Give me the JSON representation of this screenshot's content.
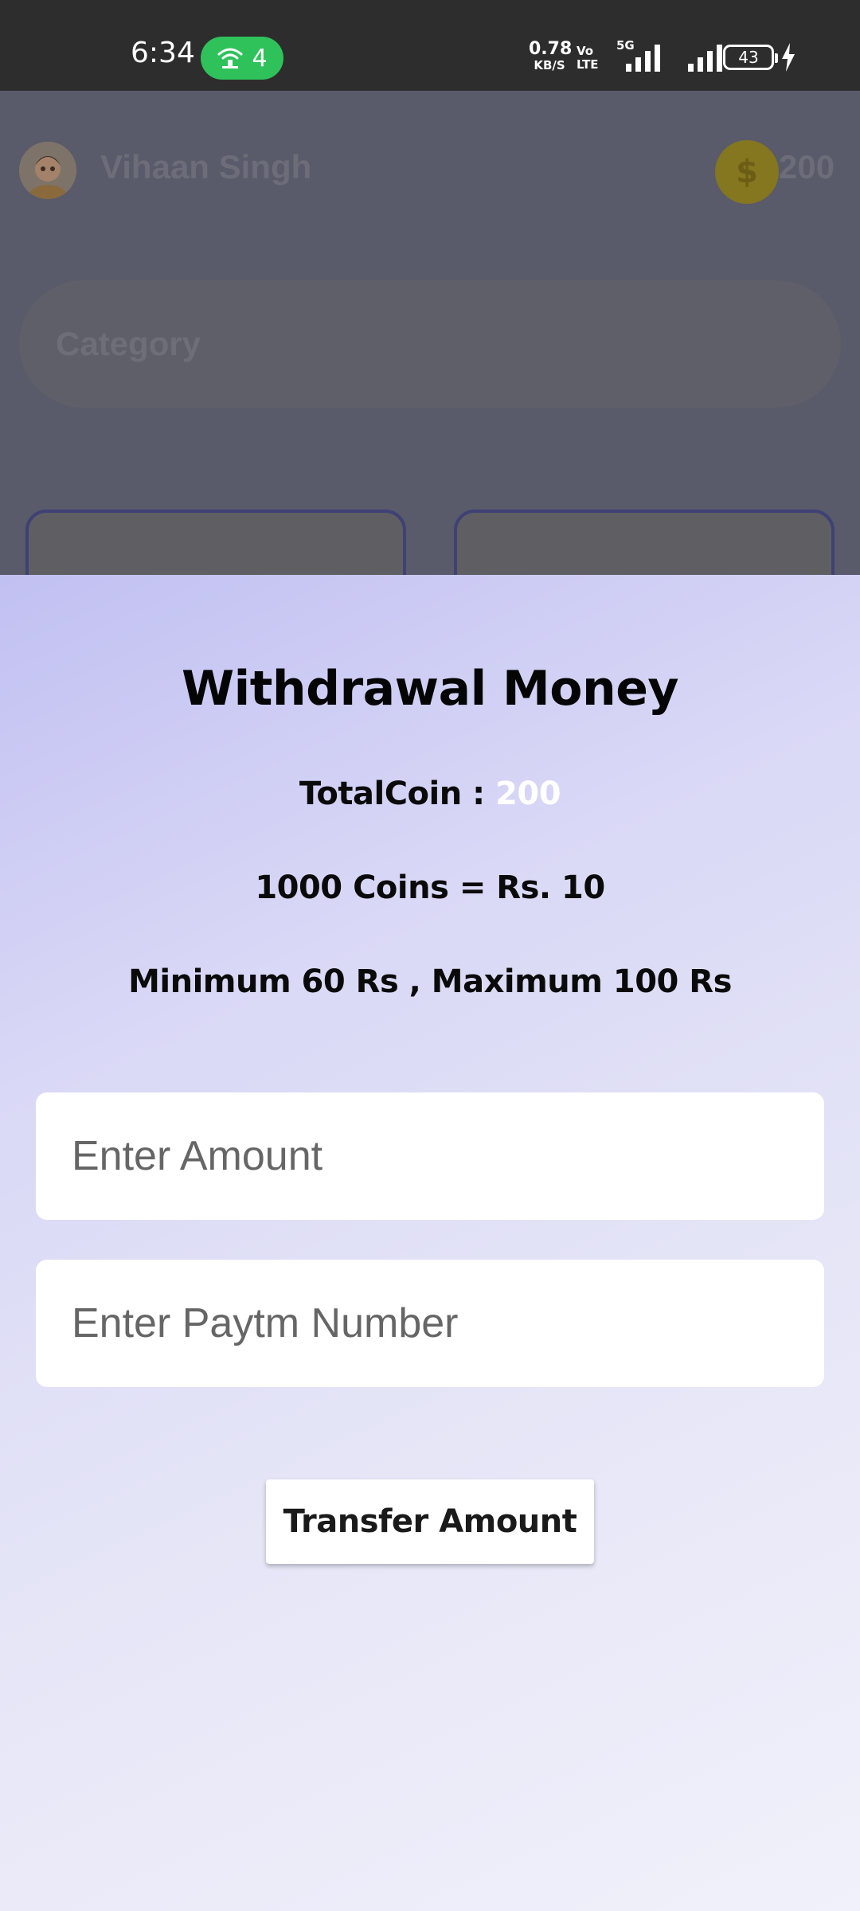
{
  "status_bar": {
    "time": "6:34",
    "hotspot_count": "4",
    "net_speed_value": "0.78",
    "net_speed_unit": "KB/S",
    "volte_top": "Vo",
    "volte_bottom": "LTE",
    "network_type": "5G",
    "battery_level": "43"
  },
  "header": {
    "user_name": "Vihaan Singh",
    "coin_symbol": "$",
    "coin_count": "200"
  },
  "category": {
    "label": "Category"
  },
  "withdrawal": {
    "title": "Withdrawal Money",
    "total_coin_label": "TotalCoin : ",
    "total_coin_value": "200",
    "rate_text": "1000 Coins = Rs. 10",
    "limit_text": "Minimum 60 Rs , Maximum 100 Rs",
    "amount_placeholder": "Enter Amount",
    "paytm_placeholder": "Enter Paytm Number",
    "transfer_label": "Transfer Amount"
  },
  "colors": {
    "accent_green": "#2fc25b",
    "sheet_gradient_start": "#c1c0f2",
    "sheet_gradient_end": "#f1f1fb",
    "coin_gold": "#857620"
  }
}
